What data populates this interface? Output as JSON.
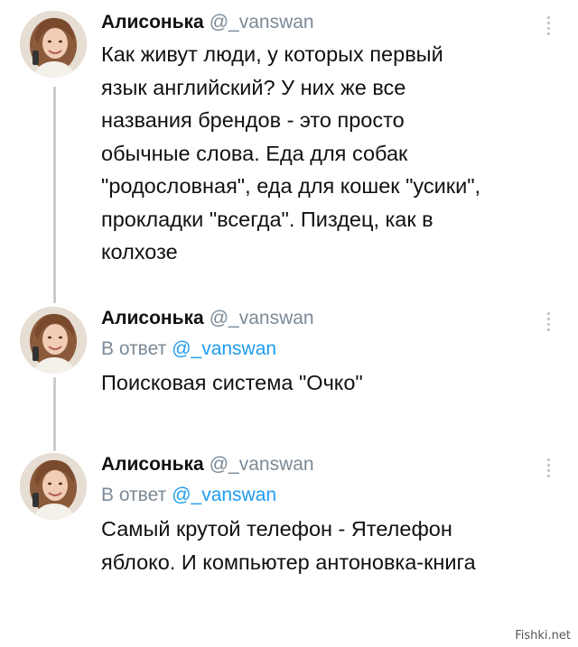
{
  "tweets": [
    {
      "name": "Алисонька",
      "handle": "@_vanswan",
      "reply_to_prefix": "",
      "reply_to_handle": "",
      "lines": [
        "Как живут люди, у которых первый",
        "язык английский? У них же все",
        "названия брендов - это просто",
        "обычные слова. Еда для собак",
        "\"родословная\", еда для кошек \"усики\",",
        "прокладки \"всегда\". Пиздец, как в",
        "колхозе"
      ]
    },
    {
      "name": "Алисонька",
      "handle": "@_vanswan",
      "reply_to_prefix": "В ответ",
      "reply_to_handle": "@_vanswan",
      "lines": [
        "Поисковая система \"Очко\""
      ]
    },
    {
      "name": "Алисонька",
      "handle": "@_vanswan",
      "reply_to_prefix": "В ответ",
      "reply_to_handle": "@_vanswan",
      "lines": [
        "Самый крутой телефон - Ятелефон",
        "яблоко. И компьютер антоновка-книга"
      ]
    }
  ],
  "icons": {
    "more": "vertical-dots-icon",
    "avatar": "avatar"
  },
  "colors": {
    "handle": "#7b8a97",
    "reply_handle": "#1d9bf0",
    "thread_line": "#c8cdd1",
    "text": "#111111"
  },
  "watermark": "Fishki.net"
}
